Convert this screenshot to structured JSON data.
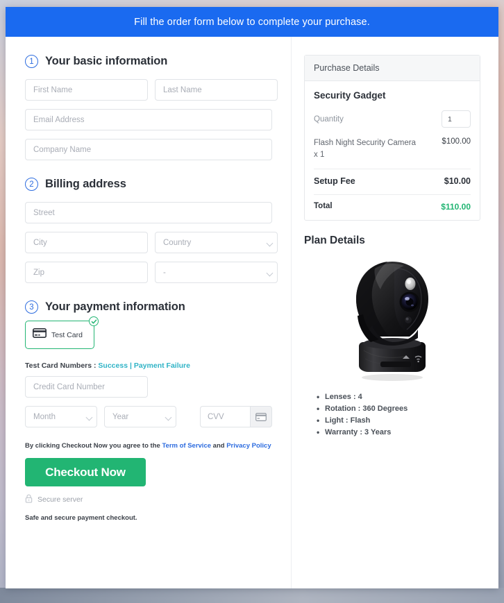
{
  "banner": {
    "text": "Fill the order form below to complete your purchase."
  },
  "steps": {
    "basic": {
      "num": "1",
      "title": "Your basic information"
    },
    "billing": {
      "num": "2",
      "title": "Billing address"
    },
    "payment": {
      "num": "3",
      "title": "Your payment information"
    }
  },
  "fields": {
    "first_name": "First Name",
    "last_name": "Last Name",
    "email": "Email Address",
    "company": "Company Name",
    "street": "Street",
    "city": "City",
    "country": "Country",
    "zip": "Zip",
    "state": "-",
    "credit_card": "Credit Card Number",
    "month": "Month",
    "year": "Year",
    "cvv": "CVV"
  },
  "payment": {
    "option_label": "Test Card",
    "option_icon": "credit-card-icon",
    "selected_badge": "check-circle-icon",
    "test_numbers_label": "Test Card Numbers :",
    "success_link": "Success",
    "separator": "|",
    "failure_link": "Payment Failure",
    "cvv_icon": "credit-card-icon"
  },
  "footer": {
    "terms_prefix": "By clicking Checkout Now you agree to the",
    "terms_link": "Term of Service",
    "terms_and": "and",
    "privacy_link": "Privacy Policy",
    "checkout_label": "Checkout Now",
    "secure_icon": "lock-icon",
    "secure_text": "Secure server",
    "safe_note": "Safe and secure payment checkout."
  },
  "purchase": {
    "header": "Purchase Details",
    "product_name": "Security Gadget",
    "quantity_label": "Quantity",
    "quantity_value": "1",
    "line_item": "Flash Night Security Camera x 1",
    "line_amount": "$100.00",
    "setup_label": "Setup Fee",
    "setup_amount": "$10.00",
    "total_label": "Total",
    "total_amount": "$110.00"
  },
  "plan": {
    "title": "Plan Details",
    "image_name": "security-camera-product-image",
    "features": [
      "Lenses : 4",
      "Rotation : 360 Degrees",
      "Light : Flash",
      "Warranty : 3 Years"
    ]
  },
  "colors": {
    "banner_blue": "#1a6af0",
    "accent_green": "#22b573",
    "link_blue": "#2d6cdf",
    "link_teal": "#2fb3c6"
  }
}
